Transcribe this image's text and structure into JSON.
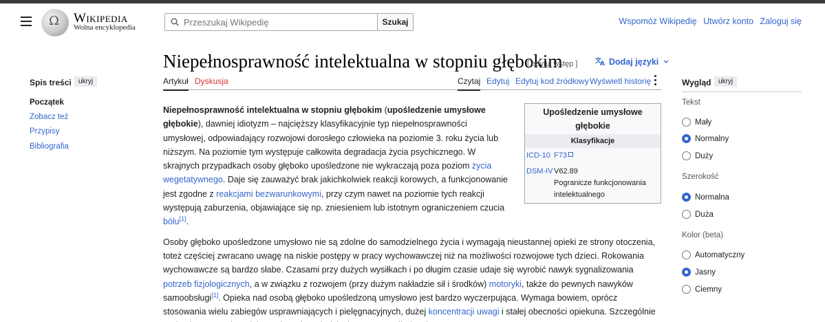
{
  "header": {
    "wordmark": "Wikipedia",
    "tagline": "Wolna encyklopedia",
    "search_placeholder": "Przeszukaj Wikipedię",
    "search_button": "Szukaj",
    "user_links": [
      "Wspomóż Wikipedię",
      "Utwórz konto",
      "Zaloguj się"
    ]
  },
  "title": "Niepełnosprawność intelektualna w stopniu głębokim",
  "edit_intro": "[ edytuj wstęp ]",
  "lang_button": "Dodaj języki",
  "tabs": {
    "article": "Artykuł",
    "talk": "Dyskusja",
    "read": "Czytaj",
    "edit": "Edytuj",
    "edit_source": "Edytuj kod źródłowy",
    "history": "Wyświetl historię"
  },
  "toc": {
    "title": "Spis treści",
    "hide": "ukryj",
    "items": [
      "Początek",
      "Zobacz też",
      "Przypisy",
      "Bibliografia"
    ]
  },
  "infobox": {
    "title": "Upośledzenie umysłowe głębokie",
    "section": "Klasyfikacje",
    "icd_label": "ICD-10",
    "icd_value": "F73",
    "dsm_label": "DSM-IV",
    "dsm_code": "V62.89",
    "dsm_desc": "Pogranicze funkcjonowania intelektualnego"
  },
  "body": {
    "p1_bold_a": "Niepełnosprawność intelektualna w stopniu głębokim",
    "p1_t1": " (",
    "p1_bold_b": "upośledzenie umysłowe głębokie",
    "p1_t2": "), dawniej idiotyzm – najcięższy klasyfikacyjnie typ niepełnosprawności umysłowej, odpowiadający rozwojowi dorosłego człowieka na poziomie 3. roku życia lub niższym. Na poziomie tym występuje całkowita degradacja życia psychicznego. W skrajnych przypadkach osoby głęboko upośledzone nie wykraczają poza poziom ",
    "p1_l1": "życia wegetatywnego",
    "p1_t3": ". Daje się zauważyć brak jakichkolwiek reakcji korowych, a funkcjonowanie jest zgodne z ",
    "p1_l2": "reakcjami bezwarunkowymi",
    "p1_t4": ", przy czym nawet na poziomie tych reakcji występują zaburzenia, objawiające się np. zniesieniem lub istotnym ograniczeniem czucia ",
    "p1_l3": "bólu",
    "ref": "[1]",
    "p1_t5": ".",
    "p2_t1": "Osoby głęboko upośledzone umysłowo nie są zdolne do samodzielnego życia i wymagają nieustannej opieki ze strony otoczenia, toteż częściej zwracano uwagę na niskie postępy w pracy wychowawczej niż na możliwości rozwojowe tych dzieci. Rokowania wychowawcze są bardzo słabe. Czasami przy dużych wysiłkach i po długim czasie udaje się wyrobić nawyk sygnalizowania ",
    "p2_l1": "potrzeb fizjologicznych",
    "p2_t2": ", a w związku z rozwojem (przy dużym nakładzie sił i środków) ",
    "p2_l2": "motoryki",
    "p2_t3": ", także do pewnych nawyków samoobsługi",
    "p2_t4": ". Opieka nad osobą głęboko upośledzoną umysłowo jest bardzo wyczerpująca. Wymaga bowiem, oprócz stosowania wielu zabiegów usprawniających i pielęgnacyjnych, dużej ",
    "p2_l3": "koncentracji uwagi",
    "p2_t5": " i stałej obecności opiekuna. Szczególnie trudna jest sytuacja rodzin wychowujących dziecko z tym upośledzeniem."
  },
  "appearance": {
    "title": "Wygląd",
    "hide": "ukryj",
    "text_label": "Tekst",
    "text_options": [
      "Mały",
      "Normalny",
      "Duży"
    ],
    "width_label": "Szerokość",
    "width_options": [
      "Normalna",
      "Duża"
    ],
    "color_label": "Kolor (beta)",
    "color_options": [
      "Automatyczny",
      "Jasny",
      "Ciemny"
    ]
  },
  "colors": {
    "link": "#3366cc",
    "redlink": "#d73333",
    "radio_checked": "#3366cc"
  }
}
